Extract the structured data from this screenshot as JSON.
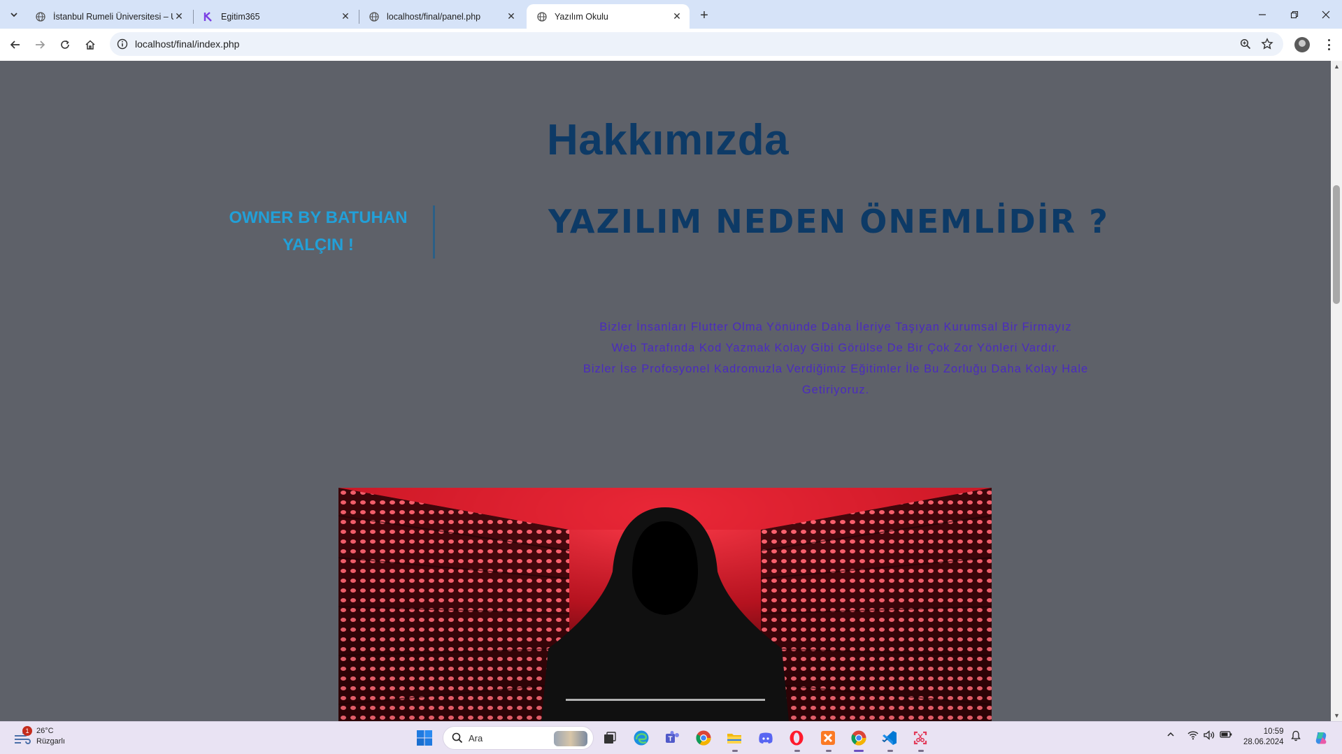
{
  "browser": {
    "tabs": [
      {
        "title": "İstanbul Rumeli Üniversitesi – U",
        "active": false
      },
      {
        "title": "Egitim365",
        "active": false
      },
      {
        "title": "localhost/final/panel.php",
        "active": false
      },
      {
        "title": "Yazılım Okulu",
        "active": true
      }
    ],
    "url": "localhost/final/index.php"
  },
  "page": {
    "heading": "Hakkımızda",
    "owner_line1": "OWNER BY BATUHAN",
    "owner_line2": "YALÇIN !",
    "subheading": "YAZILIM NEDEN ÖNEMLİDİR ?",
    "paragraph": [
      "Bizler İnsanları Flutter Olma Yönünde Daha İleriye Taşıyan Kurumsal Bir Firmayız",
      "Web Tarafında Kod Yazmak Kolay Gibi Görülse De Bir Çok Zor Yönleri Vardır.",
      "Bizler İse Profosyonel Kadromuzla Verdiğimiz Eğitimler İle Bu Zorluğu Daha Kolay Hale",
      "Getiriyoruz."
    ],
    "colors": {
      "background": "#5e6169",
      "heading": "#0d3a66",
      "owner": "#22a0d8",
      "paragraph": "#4a2bbf"
    }
  },
  "taskbar": {
    "weather_temp": "26°C",
    "weather_desc": "Rüzgarlı",
    "weather_badge": "1",
    "search_placeholder": "Ara",
    "time": "10:59",
    "date": "28.06.2024",
    "apps": [
      "start-icon",
      "search-icon",
      "task-view-icon",
      "edge-icon",
      "teams-icon",
      "chrome-icon",
      "file-explorer-icon",
      "discord-icon",
      "opera-icon",
      "xampp-icon",
      "chrome-icon",
      "vscode-icon",
      "snipping-tool-icon"
    ]
  }
}
